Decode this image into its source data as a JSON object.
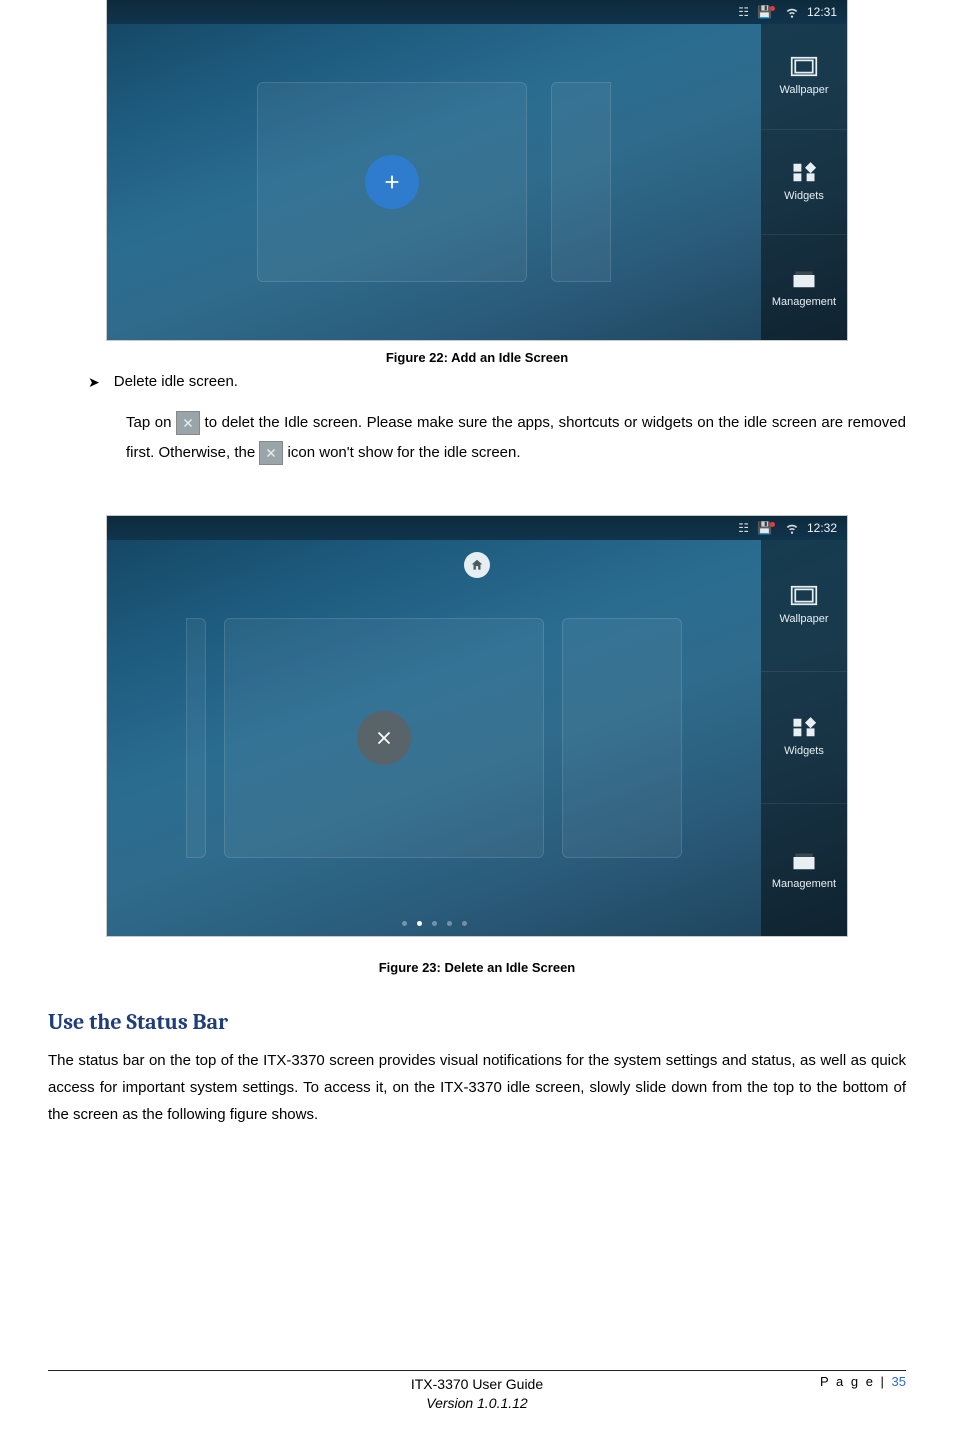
{
  "figure22": {
    "caption": "Figure 22: Add an Idle Screen",
    "status_time": "12:31",
    "sidebar": [
      "Wallpaper",
      "Widgets",
      "Management"
    ]
  },
  "figure23": {
    "caption": "Figure 23: Delete an Idle Screen",
    "status_time": "12:32",
    "sidebar": [
      "Wallpaper",
      "Widgets",
      "Management"
    ]
  },
  "bullet_heading": "Delete idle screen.",
  "para_a": "Tap on ",
  "para_b": "to delet the Idle screen. Please make sure the apps, shortcuts or widgets on the idle screen are removed first. Otherwise, the ",
  "para_c": " icon won't show for the idle screen.",
  "section_heading": "Use the Status Bar",
  "section_para": "The status bar on the top of the ITX-3370 screen provides visual notifications for the system settings and status, as well as quick access for important system settings. To access it, on the ITX-3370 idle screen, slowly slide down from the top to the bottom of the screen as the following figure shows.",
  "footer": {
    "page_label": "P a g e | ",
    "page_num": "35",
    "guide": "ITX-3370 User Guide",
    "version": "Version 1.0.1.12"
  }
}
